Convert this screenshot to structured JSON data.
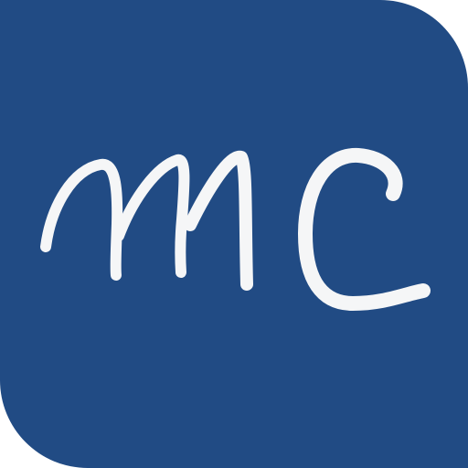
{
  "logo": {
    "text": "mc",
    "background_color": "#214b84",
    "glyph_color": "#f5f6f7",
    "style": "handwritten monogram"
  }
}
